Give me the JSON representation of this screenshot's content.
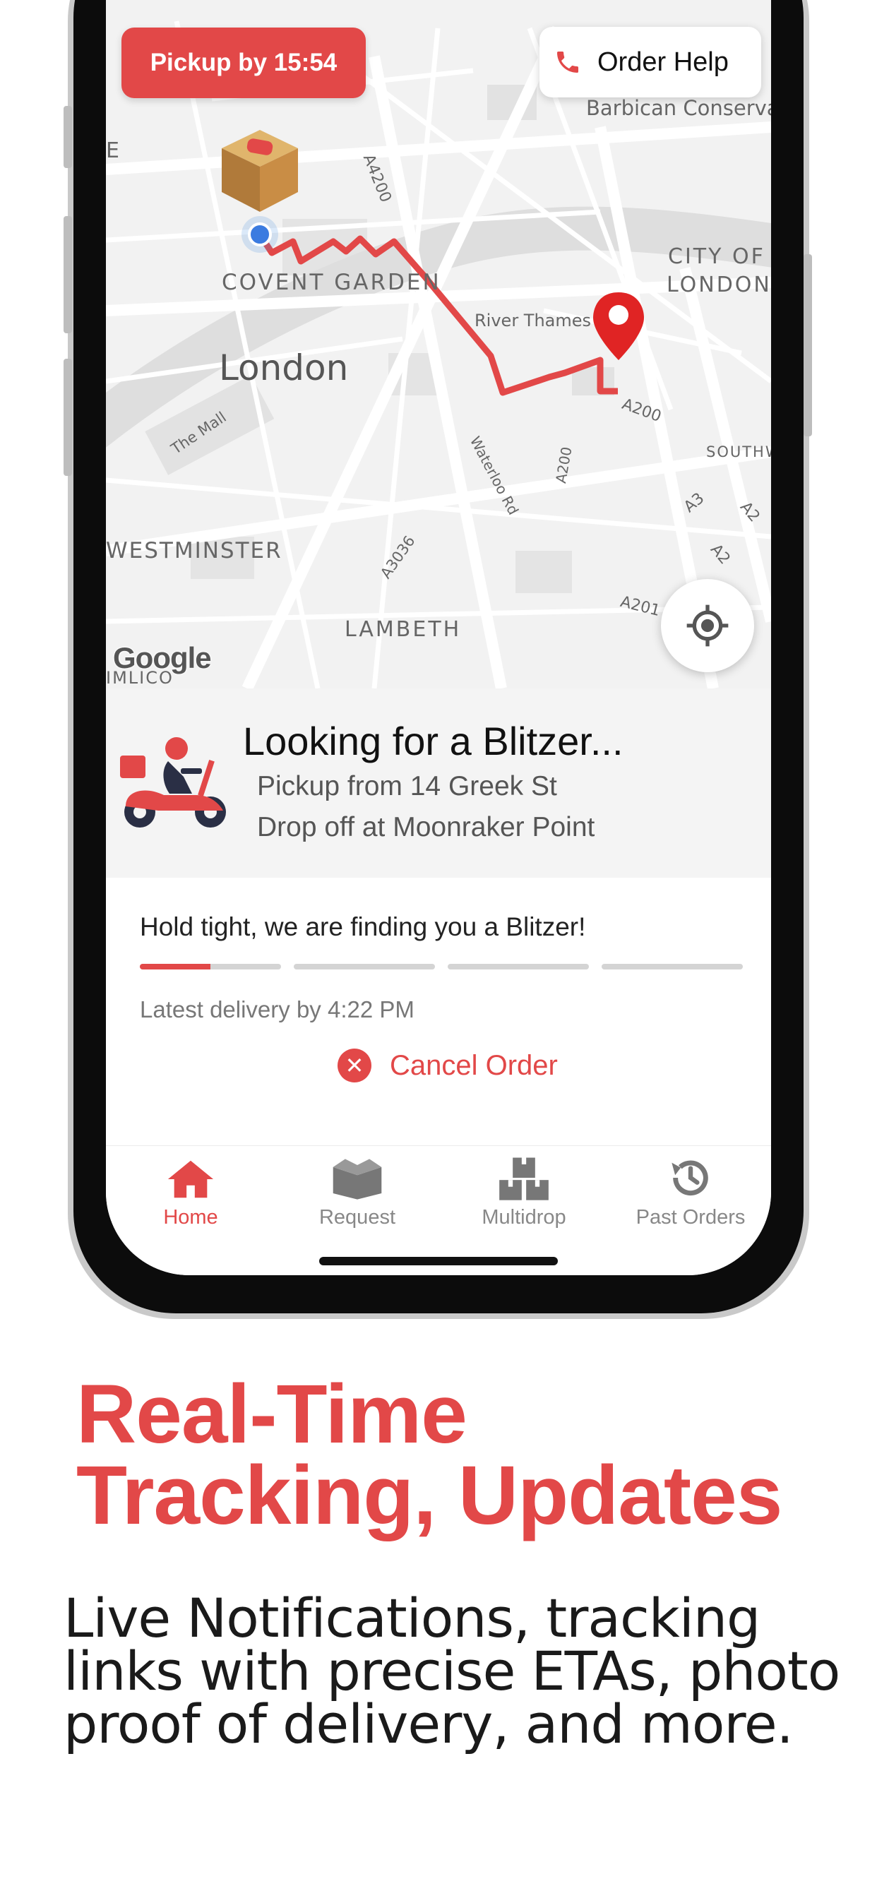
{
  "map": {
    "pickup_badge": "Pickup by 15:54",
    "help_button": "Order Help",
    "labels": {
      "barbican": "Barbican Conserva",
      "covent_garden": "COVENT GARDEN",
      "london": "London",
      "city_of": "CITY OF",
      "city_london": "LONDON",
      "river_thames": "River Thames",
      "the_mall": "The Mall",
      "waterloo_rd": "Waterloo Rd",
      "westminster": "WESTMINSTER",
      "lambeth": "LAMBETH",
      "southwark": "SOUTHW",
      "a4200": "A4200",
      "a200_top": "A200",
      "a200_mid": "A200",
      "a3": "A3",
      "a2_a": "A2",
      "a2_b": "A2",
      "a3036": "A3036",
      "a201": "A201",
      "pimlico": "IMLICO",
      "edge_e": "E"
    },
    "google": "Google",
    "icons": [
      "package-icon",
      "phone-icon",
      "location-pin-icon",
      "locate-icon"
    ]
  },
  "status": {
    "title": "Looking for a Blitzer...",
    "pickup": "Pickup from 14 Greek St",
    "dropoff": "Drop off at Moonraker Point"
  },
  "progress": {
    "message": "Hold tight, we are finding you a Blitzer!",
    "latest": "Latest delivery by 4:22 PM",
    "segments": 4,
    "first_segment_fill": 0.5,
    "cancel_label": "Cancel Order"
  },
  "tabs": [
    {
      "label": "Home",
      "icon": "home-icon",
      "active": true
    },
    {
      "label": "Request",
      "icon": "box-icon",
      "active": false
    },
    {
      "label": "Multidrop",
      "icon": "boxes-icon",
      "active": false
    },
    {
      "label": "Past Orders",
      "icon": "history-icon",
      "active": false
    }
  ],
  "marketing": {
    "headline_line1": "Real-Time",
    "headline_line2": "Tracking, Updates",
    "subcopy_line1": "Live Notifications, tracking",
    "subcopy_line2": "links with precise ETAs, photo",
    "subcopy_line3": "proof of delivery, and more."
  },
  "colors": {
    "accent": "#e24848",
    "map_bg": "#f3f3f3",
    "inactive": "#888888"
  }
}
